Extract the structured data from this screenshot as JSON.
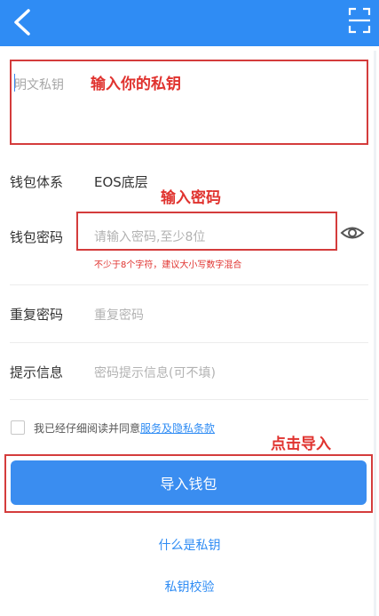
{
  "header": {
    "background": "#2f8cf4",
    "back_icon": "back-arrow-icon",
    "scan_icon": "scan-icon"
  },
  "key_field": {
    "placeholder": "明文私钥",
    "annotation": "输入你的私钥"
  },
  "wallet_system": {
    "label": "钱包体系",
    "value": "EOS底层"
  },
  "password": {
    "label": "钱包密码",
    "placeholder": "请输入密码,至少8位",
    "annotation": "输入密码",
    "hint": "不少于8个字符，建议大小写数字混合",
    "eye_icon": "eye-icon"
  },
  "repeat_password": {
    "label": "重复密码",
    "placeholder": "重复密码"
  },
  "prompt_info": {
    "label": "提示信息",
    "placeholder": "密码提示信息(可不填)"
  },
  "agreement": {
    "text": "我已经仔细阅读并同意",
    "link": "服务及隐私条款"
  },
  "import_button": {
    "label": "导入钱包",
    "annotation": "点击导入"
  },
  "links": {
    "what_is_key": "什么是私钥",
    "key_verify": "私钥校验"
  },
  "colors": {
    "accent": "#2f8cf4",
    "annotation": "#e0332f"
  }
}
